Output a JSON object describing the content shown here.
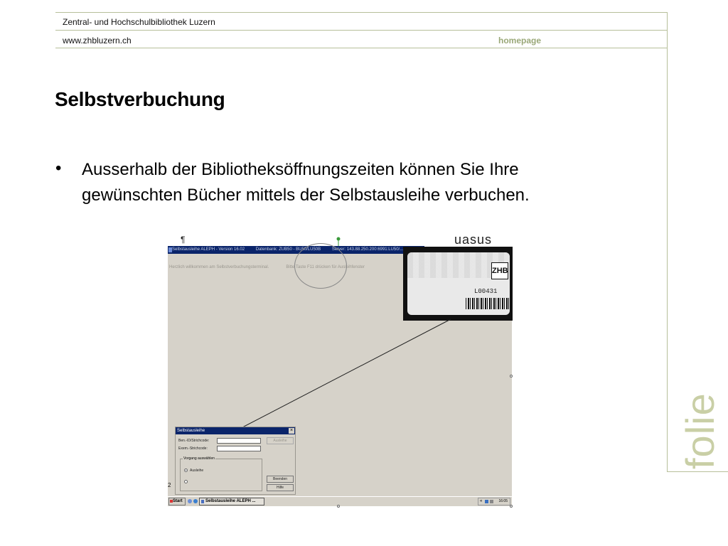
{
  "header": {
    "institution": "Zentral- und Hochschulbibliothek Luzern",
    "url": "www.zhbluzern.ch",
    "homepage_link": "homepage"
  },
  "slide": {
    "title": "Selbstverbuchung",
    "bullet_symbol": "•",
    "bullet_text": "Ausserhalb der Bibliotheksöffnungszeiten können Sie Ihre gewünschten Bücher mittels der Selbstausleihe verbuchen.",
    "side_label": "folie",
    "pilcrow": "¶",
    "side_mark": "2"
  },
  "screenshot": {
    "titlebar": {
      "app": "Selbstausleihe ALEPH - Version 16.02",
      "database": "Datenbank: ZUB50 - BU50/LU50B",
      "server": "Server: 143.88.250.200:6991:LU50/..."
    },
    "welcome": "Herzlich willkommen am Selbstverbuchungsterminal.",
    "instruction": "Bitte Taste F11 drücken für Ausleihfenster",
    "dialog": {
      "title": "Selbstausleihe",
      "close": "×",
      "patron_label": "Ben.-ID/Strichcode:",
      "item_label": "Exem.-Strichcode:",
      "checkout_button": "Ausleihe",
      "group_label": "Vorgang auswählen",
      "option_checkout": "Ausleihe",
      "end_button": "Beenden",
      "help_button": "Hilfe"
    },
    "taskbar": {
      "start": "Start",
      "task": "Selbstausleihe ALEPH ...",
      "tray_chevron": "«",
      "clock": "16:05"
    }
  },
  "card": {
    "code": "L00431",
    "logo": "ZHB",
    "stripe_text": "uasus"
  },
  "colors": {
    "frame_line": "#b7bf9a",
    "homepage": "#9aa878",
    "side_label": "#c9cfa6",
    "titlebar": "#0a246a",
    "window_bg": "#d6d2c9"
  }
}
